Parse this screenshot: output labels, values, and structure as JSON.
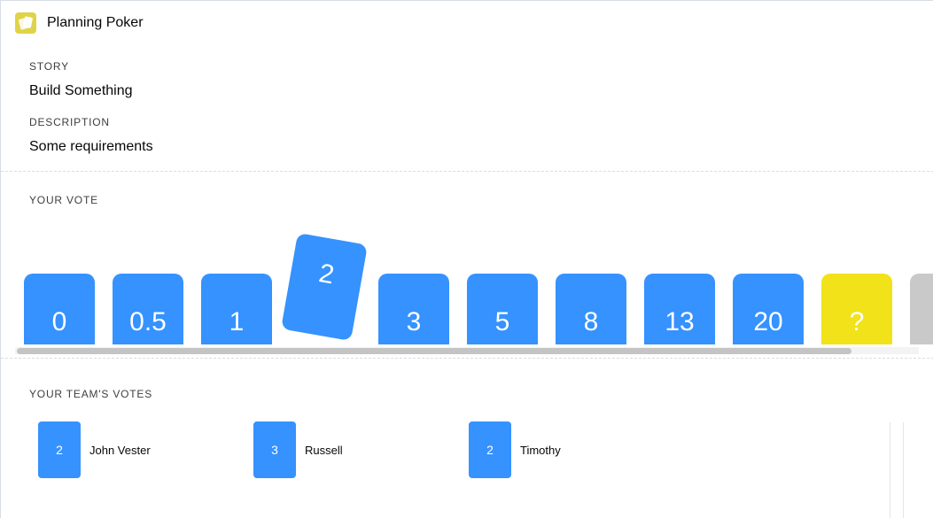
{
  "header": {
    "title": "Planning Poker",
    "icon": "planning-poker-app-icon"
  },
  "story": {
    "label": "STORY",
    "value": "Build Something"
  },
  "description": {
    "label": "DESCRIPTION",
    "value": "Some requirements"
  },
  "vote": {
    "label": "YOUR VOTE",
    "cards": [
      "0",
      "0.5",
      "1",
      "2",
      "3",
      "5",
      "8",
      "13",
      "20",
      "?"
    ],
    "selected": "2"
  },
  "team": {
    "label": "YOUR TEAM'S VOTES",
    "votes": [
      {
        "value": "2",
        "name": "John Vester"
      },
      {
        "value": "3",
        "name": "Russell"
      },
      {
        "value": "2",
        "name": "Timothy"
      }
    ]
  },
  "colors": {
    "card": "#3592ff",
    "question_card": "#f1e21a",
    "app_icon": "#e0d34a"
  }
}
